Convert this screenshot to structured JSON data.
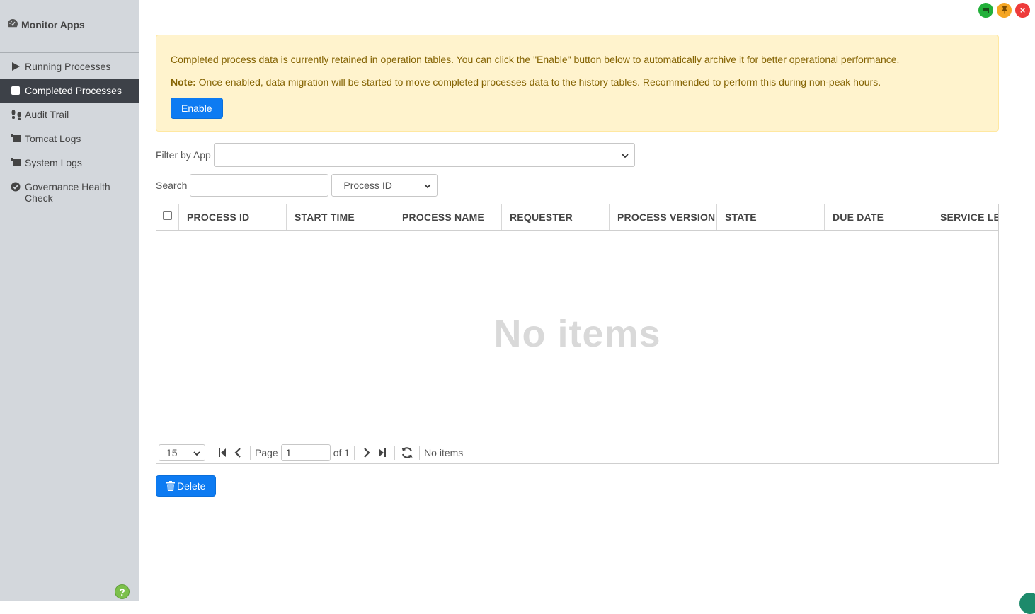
{
  "sidebar": {
    "title": "Monitor Apps",
    "items": [
      {
        "label": "Running Processes",
        "icon": "play-icon"
      },
      {
        "label": "Completed Processes",
        "icon": "square-icon",
        "active": true
      },
      {
        "label": "Audit Trail",
        "icon": "footsteps-icon"
      },
      {
        "label": "Tomcat Logs",
        "icon": "log-icon"
      },
      {
        "label": "System Logs",
        "icon": "log-icon"
      },
      {
        "label": "Governance Health Check",
        "icon": "check-circle-icon"
      }
    ],
    "help": "?"
  },
  "window_controls": {
    "close": "×"
  },
  "alert": {
    "message": "Completed process data is currently retained in operation tables. You can click the \"Enable\" button below to automatically archive it for better operational performance.",
    "note_label": "Note:",
    "note_text": " Once enabled, data migration will be started to move completed processes data to the history tables. Recommended to perform this during non-peak hours.",
    "enable_label": "Enable"
  },
  "filter": {
    "label": "Filter by App",
    "value": ""
  },
  "search": {
    "label": "Search",
    "value": "",
    "field_selected": "Process ID"
  },
  "grid": {
    "columns": [
      "PROCESS ID",
      "START TIME",
      "PROCESS NAME",
      "REQUESTER",
      "PROCESS VERSION",
      "STATE",
      "DUE DATE",
      "SERVICE LE"
    ],
    "empty_text": "No items"
  },
  "pager": {
    "page_size": "15",
    "page_label": "Page",
    "page_value": "1",
    "of_label": "of 1",
    "status": "No items"
  },
  "delete_label": "Delete",
  "colors": {
    "accent": "#0d7bf2",
    "alert_bg": "#fff3cd",
    "sidebar_bg": "#d3d7dc",
    "active_bg": "#3d4148"
  }
}
